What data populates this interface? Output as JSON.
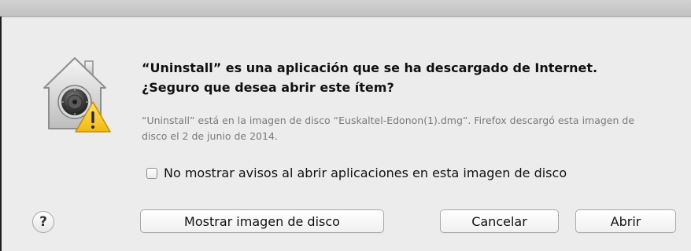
{
  "dialog": {
    "headline": "“Uninstall” es una aplicación que se ha descargado de Internet. ¿Seguro que desea abrir este ítem?",
    "info": "“Uninstall” está en la imagen de disco “Euskaltel-Edonon(1).dmg”. Firefox descargó esta imagen de disco el 2 de junio de 2014.",
    "checkbox": {
      "label": "No mostrar avisos al abrir aplicaciones en esta imagen de disco",
      "checked": false
    },
    "help_label": "?",
    "buttons": {
      "show": "Mostrar imagen de disco",
      "cancel": "Cancelar",
      "open": "Abrir"
    },
    "icon": "gatekeeper-security-icon",
    "warning_icon": "warning-triangle-icon",
    "colors": {
      "background": "#ececec",
      "warning": "#f6c21a"
    }
  }
}
